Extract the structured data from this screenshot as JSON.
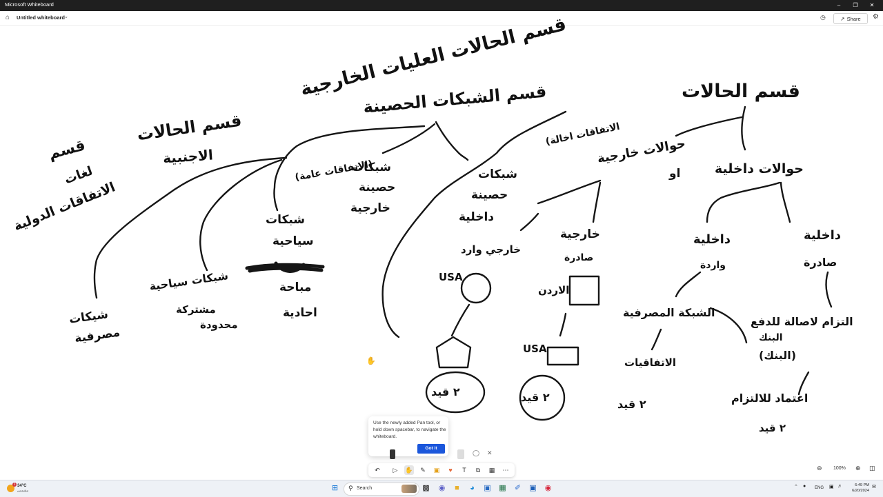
{
  "window": {
    "app_title": "Microsoft Whiteboard"
  },
  "header": {
    "home_icon": "home-icon",
    "board_title": "Untitled whiteboard",
    "share_label": "Share"
  },
  "canvas": {
    "handwriting": [
      "قسم الحالات العليات الخارجية",
      "قسم الشبكات الحصينة",
      "قسم الحالات",
      "قسم الحالات",
      "الاجنبية",
      "قسم",
      "لغات",
      "الاتفاقات الدولية",
      "(الاتفاقات عامة)",
      "الاتفاقات اخالة)",
      "حوالات خارجية",
      "حوالات داخلية",
      "او",
      "شبكات",
      "حصينة",
      "خارجية",
      "شبكات",
      "حصينة",
      "داخلية",
      "شبكات",
      "سياحية",
      "مباحة",
      "احادية",
      "شبكات سياحية",
      "مشتركة",
      "محدودة",
      "شيكات",
      "مصرفية",
      "خارجي وارد",
      "USA",
      "خارجية",
      "صادرة",
      "الاردن",
      "USA",
      "داخلية",
      "واردة",
      "داخلية",
      "صادرة",
      "الشبكة المصرفية",
      "الاتفاقيات",
      "التزام لاصالة للدفع",
      "البنك",
      "(البنك)",
      "اعتماد للالتزام",
      "٢ قيد",
      "٢ قيد",
      "٢ قيد",
      "٢ قيد"
    ]
  },
  "tooltip": {
    "text": "Use the newly added Pan tool, or hold down spacebar, to navigate the whiteboard.",
    "button_label": "Got it"
  },
  "zoom": {
    "level": "100%"
  },
  "taskbar": {
    "weather_temp": "34°C",
    "weather_condition": "مشمس",
    "weather_badge": "1",
    "search_placeholder": "Search",
    "language": "ENG",
    "time": "6:49 PM",
    "date": "6/20/2024"
  }
}
